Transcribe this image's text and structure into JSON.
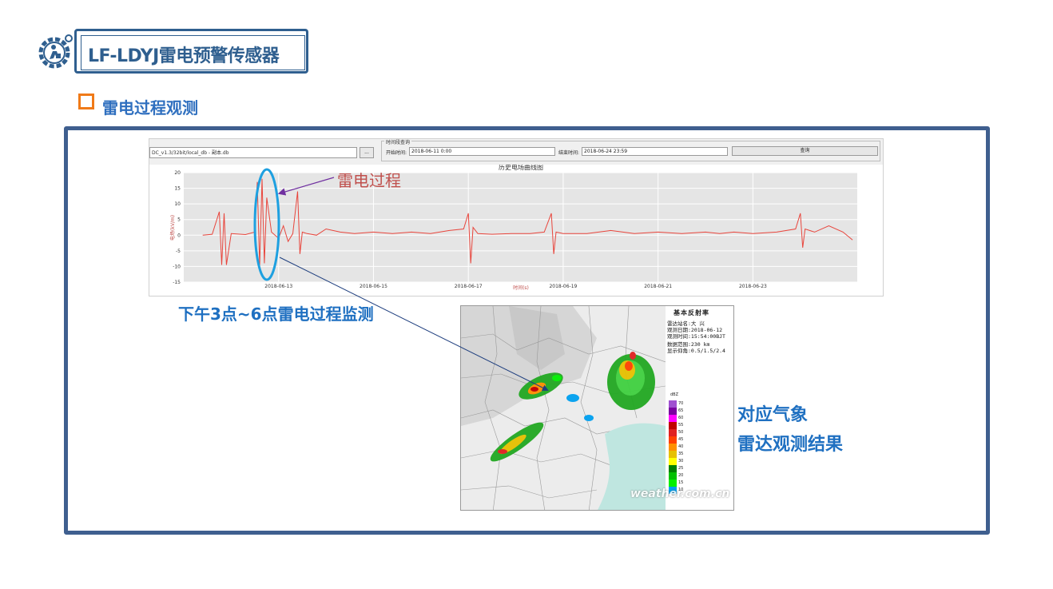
{
  "header": {
    "title": "LF-LDYJ雷电预警传感器",
    "logo_icon": "gear-person-icon",
    "color": "#2f5f8f"
  },
  "section": {
    "title": "雷电过程观测",
    "marker_color": "#f07a18",
    "title_color": "#2f6fbf"
  },
  "software": {
    "file_path": "DC_v1.3/32bit/local_db - 副本.db",
    "browse_label": "...",
    "group_label": "时间段查询",
    "start_label": "开始时间:",
    "start_value": "2018-06-11  0:00",
    "end_label": "结束时间:",
    "end_value": "2018-06-24  23:59",
    "query_button": "查询",
    "chart_title": "历史电场曲线图"
  },
  "chart_data": {
    "type": "line",
    "title": "历史电场曲线图",
    "xlabel": "时间(s)",
    "ylabel": "电场(kV/m)",
    "ylim": [
      -15,
      20
    ],
    "yticks": [
      "20",
      "15",
      "10",
      "5",
      "0",
      "-5",
      "-10",
      "-15"
    ],
    "xticks": [
      "2018-06-13",
      "2018-06-15",
      "2018-06-17",
      "2018-06-19",
      "2018-06-21",
      "2018-06-23"
    ],
    "grid": true,
    "line_color": "#e8453c",
    "series": [
      {
        "x": [
          11.4,
          11.6,
          11.75,
          11.8,
          11.85,
          11.9,
          12.0,
          12.3,
          12.5,
          12.55,
          12.6,
          12.65,
          12.7,
          12.75,
          12.85,
          13.0,
          13.1,
          13.2,
          13.3,
          13.4,
          13.45,
          13.5,
          13.6,
          13.8,
          14.0,
          14.3,
          14.6,
          15.0,
          15.4,
          15.8,
          16.2,
          16.6,
          16.9,
          17.0,
          17.05,
          17.1,
          17.2,
          17.5,
          17.9,
          18.3,
          18.6,
          18.75,
          18.8,
          18.85,
          19.0,
          19.5,
          20.0,
          20.5,
          21.0,
          21.5,
          22.0,
          22.3,
          22.6,
          23.0,
          23.5,
          23.9,
          24.0,
          24.05,
          24.1,
          24.3,
          24.6,
          24.9,
          25.1
        ],
        "y": [
          0,
          0.3,
          7.5,
          -9.5,
          7,
          -9.5,
          0.5,
          0.2,
          1,
          17,
          -10,
          18,
          -9,
          12,
          1,
          -1,
          3,
          -2,
          0.5,
          14,
          -6,
          1,
          0.5,
          0,
          2,
          1,
          0.5,
          1,
          0.5,
          1,
          0.5,
          1.5,
          2,
          7,
          -9,
          2.5,
          0.5,
          0.3,
          0.5,
          0.5,
          1,
          7,
          -6,
          1,
          0.5,
          0.5,
          1.5,
          0.5,
          1,
          0.5,
          1,
          0.5,
          1,
          0.5,
          1,
          2,
          7,
          -4,
          2,
          1,
          3,
          1,
          -1.5
        ]
      }
    ]
  },
  "annotations": {
    "lightning_process": "雷电过程",
    "monitoring": "下午3点~6点雷电过程监测",
    "radar_line1": "对应气象",
    "radar_line2": "雷达观测结果",
    "ellipse_color": "#1ea0e0",
    "arrow_color": "#7030a0",
    "connector_color": "#1f3f7f"
  },
  "radar": {
    "title": "基本反射率",
    "station": "雷达站名:大 兴",
    "date": "观测日期:2018-06-12",
    "time": "观测时间:15:54:00BJT",
    "range": "数据范围:230 km",
    "elevation": "显示仰角:0.5/1.5/2.4",
    "unit": "dBZ",
    "watermark": "weather.com.cn",
    "legend": [
      {
        "value": "70",
        "color": "#a050d0"
      },
      {
        "value": "65",
        "color": "#7a00a0"
      },
      {
        "value": "60",
        "color": "#ff00ff"
      },
      {
        "value": "55",
        "color": "#c00000"
      },
      {
        "value": "50",
        "color": "#e02020"
      },
      {
        "value": "45",
        "color": "#ff4000"
      },
      {
        "value": "40",
        "color": "#ff9000"
      },
      {
        "value": "35",
        "color": "#e6c000"
      },
      {
        "value": "30",
        "color": "#ffff00"
      },
      {
        "value": "25",
        "color": "#008000"
      },
      {
        "value": "20",
        "color": "#00c000"
      },
      {
        "value": "15",
        "color": "#00f000"
      },
      {
        "value": "10",
        "color": "#00a0f0"
      }
    ]
  }
}
